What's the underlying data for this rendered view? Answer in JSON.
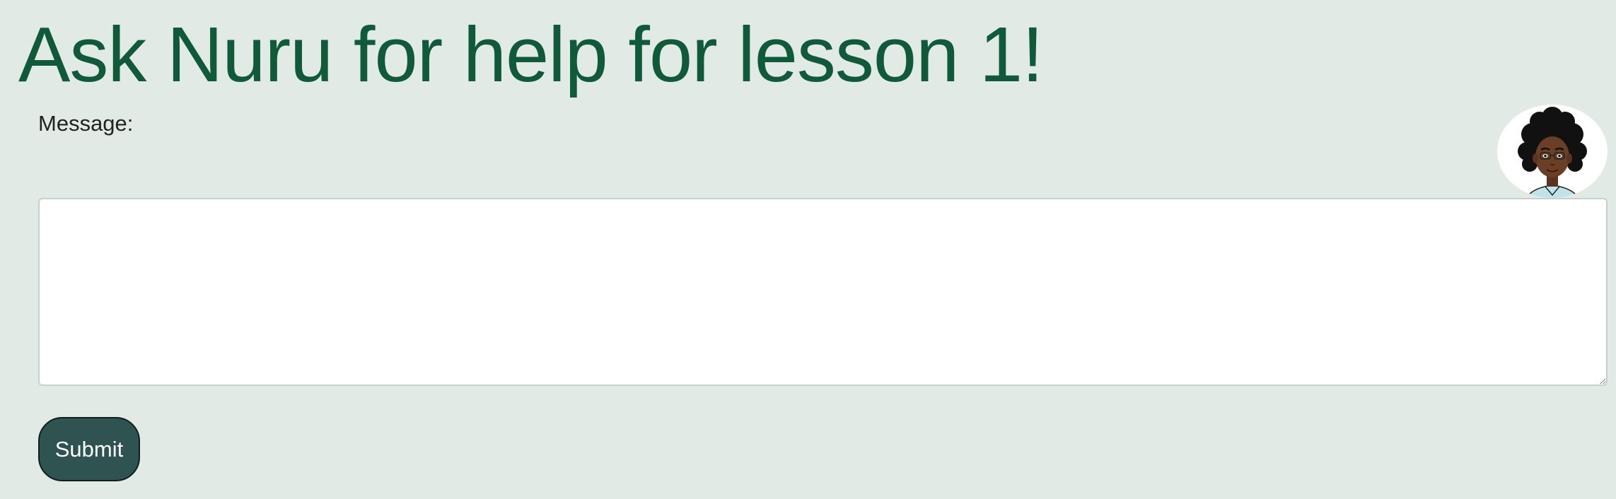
{
  "header": {
    "title": "Ask Nuru for help for lesson 1!"
  },
  "form": {
    "message_label": "Message:",
    "message_value": "",
    "submit_label": "Submit"
  },
  "avatar": {
    "icon": "cartoon-person-avatar"
  },
  "colors": {
    "background": "#e1eae5",
    "title": "#10593a",
    "button": "#2f5351"
  }
}
